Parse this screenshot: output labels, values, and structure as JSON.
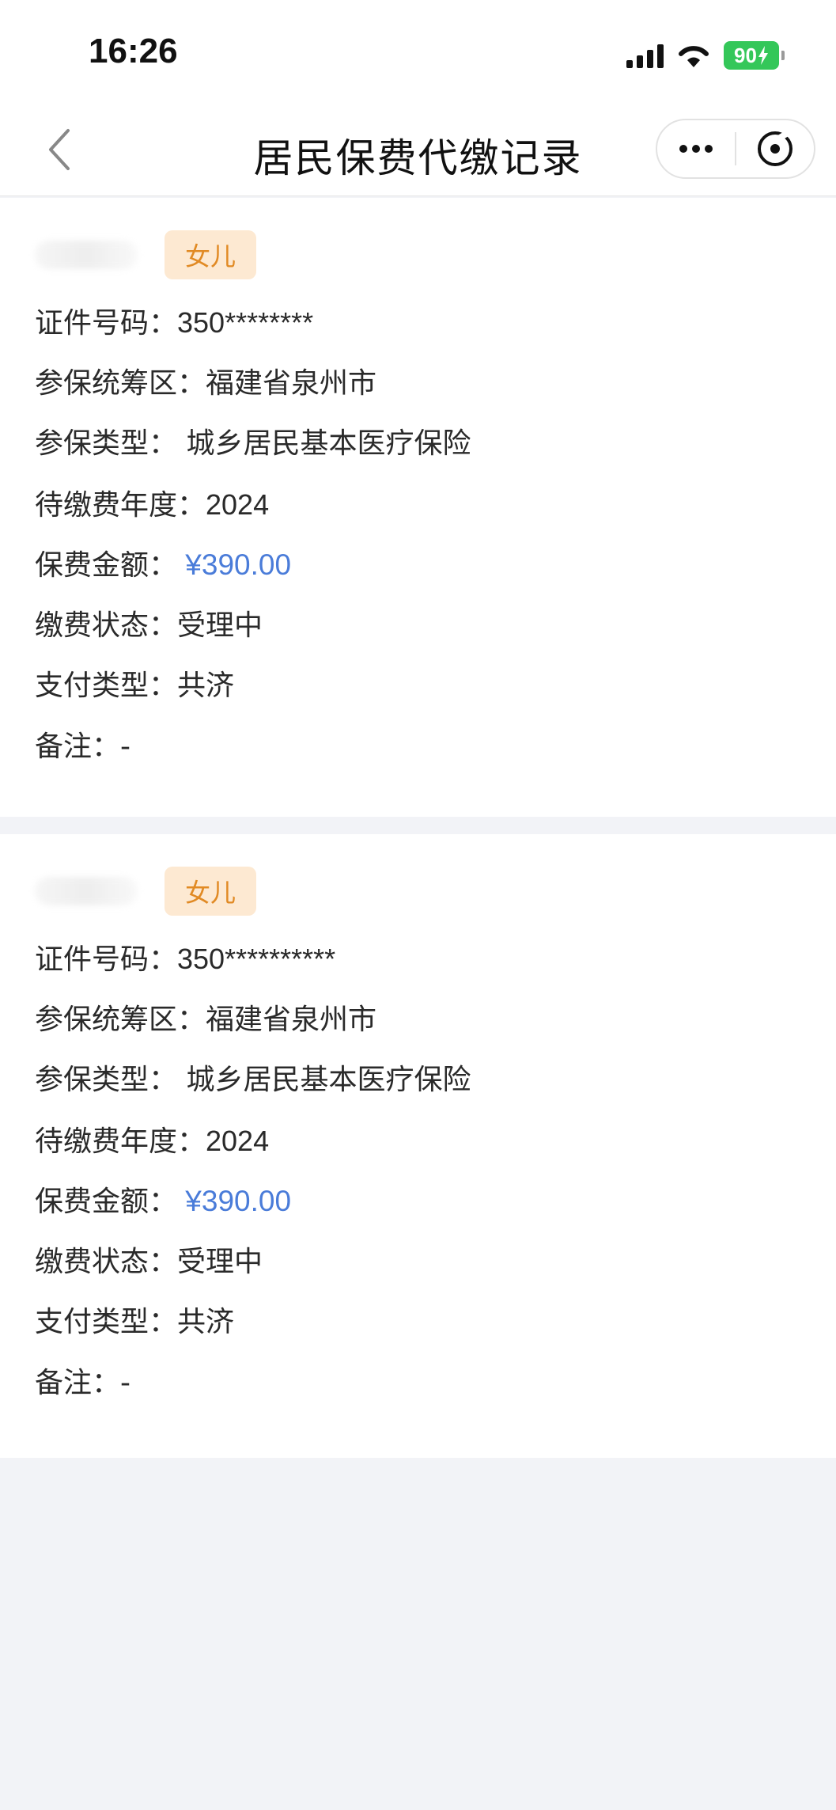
{
  "status_bar": {
    "time": "16:26",
    "battery": "90",
    "icons": [
      "signal-icon",
      "wifi-icon",
      "battery-icon"
    ]
  },
  "nav": {
    "title": "居民保费代缴记录",
    "icons": [
      "back-arrow-icon",
      "more-icon",
      "close-mini-program-icon"
    ]
  },
  "colors": {
    "tag_text": "#e18a24",
    "tag_bg": "#fde9d2",
    "amount": "#4a7cd9",
    "page_bg": "#f2f3f7"
  },
  "records": [
    {
      "relation": "女儿",
      "fields": [
        {
          "label": "证件号码：",
          "value": "350********"
        },
        {
          "label": "参保统筹区：",
          "value": "福建省泉州市"
        },
        {
          "label": "参保类型：",
          "value": " 城乡居民基本医疗保险"
        },
        {
          "label": "待缴费年度：",
          "value": "2024"
        },
        {
          "label": "保费金额：",
          "value": " ¥390.00"
        },
        {
          "label": "缴费状态：",
          "value": "受理中"
        },
        {
          "label": "支付类型：",
          "value": "共济"
        },
        {
          "label": "备注：",
          "value": "-"
        }
      ]
    },
    {
      "relation": "女儿",
      "fields": [
        {
          "label": "证件号码：",
          "value": "350**********"
        },
        {
          "label": "参保统筹区：",
          "value": "福建省泉州市"
        },
        {
          "label": "参保类型：",
          "value": " 城乡居民基本医疗保险"
        },
        {
          "label": "待缴费年度：",
          "value": "2024"
        },
        {
          "label": "保费金额：",
          "value": " ¥390.00"
        },
        {
          "label": "缴费状态：",
          "value": "受理中"
        },
        {
          "label": "支付类型：",
          "value": "共济"
        },
        {
          "label": "备注：",
          "value": "-"
        }
      ]
    }
  ]
}
